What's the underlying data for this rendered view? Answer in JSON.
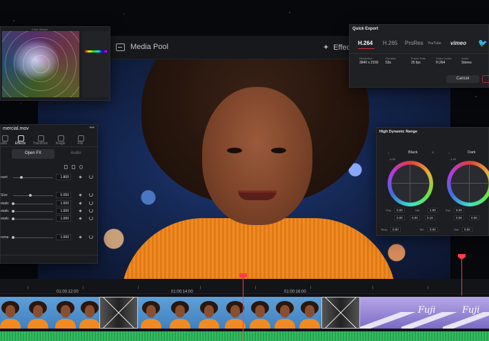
{
  "topbar": {
    "media_pool": "Media Pool",
    "effects": "Effec"
  },
  "scope_panel": {
    "title": "Color Warper"
  },
  "inspector": {
    "filename": "mercial.mov",
    "tabs": [
      {
        "label": "udio"
      },
      {
        "label": "Effects"
      },
      {
        "label": "Transition"
      },
      {
        "label": "Image"
      },
      {
        "label": "File"
      }
    ],
    "subtabs": [
      "Open FX",
      "Audio"
    ],
    "rows": [
      {
        "label": "ount",
        "value": "1.800"
      },
      {
        "label": "Size",
        "value": "0.050"
      },
      {
        "label": "etails",
        "value": "1.000"
      },
      {
        "label": "etails",
        "value": "1.000"
      },
      {
        "label": "etails",
        "value": "1.000"
      },
      {
        "label": "roma",
        "value": "1.000"
      }
    ]
  },
  "quick_export": {
    "title": "Quick Export",
    "formats": [
      "H.264",
      "H.265",
      "ProRes",
      "YouTube",
      "vimeo"
    ],
    "specs": [
      {
        "label": "Resolution",
        "value": "3840 x 2160"
      },
      {
        "label": "Duration",
        "value": "53s"
      },
      {
        "label": "Frame Rate",
        "value": "25 fps"
      },
      {
        "label": "Video Codec",
        "value": "H.264"
      },
      {
        "label": "Audio",
        "value": "Stereo"
      }
    ],
    "cancel": "Cancel"
  },
  "hdr": {
    "title": "High Dynamic Range",
    "zones": [
      {
        "name": "Black",
        "top_value": "-4.00",
        "exp": "0.00",
        "sat": "1.00",
        "x": "0.00",
        "y": "0.00",
        "z": "0.10"
      },
      {
        "name": "Dark",
        "top_value": "-1.00",
        "exp": "0.00",
        "sat": "",
        "x": "0.00",
        "y": "0.00",
        "z": ""
      }
    ],
    "labels": {
      "exp": "Exp",
      "sat": "Sat",
      "temp": "Temp",
      "tint": "Tint",
      "hue": "Hue"
    },
    "temp": "0.00",
    "tint": "0.00",
    "hue": "0.00"
  },
  "timeline": {
    "timecodes": [
      "01:00:12:00",
      "01:00:14:00",
      "01:00:16:00"
    ],
    "title_card": "Fuji"
  },
  "colors": {
    "accent_red": "#ff3b4e",
    "audio_green": "#2fb35a",
    "clip_blue": "#4a8fd0"
  }
}
